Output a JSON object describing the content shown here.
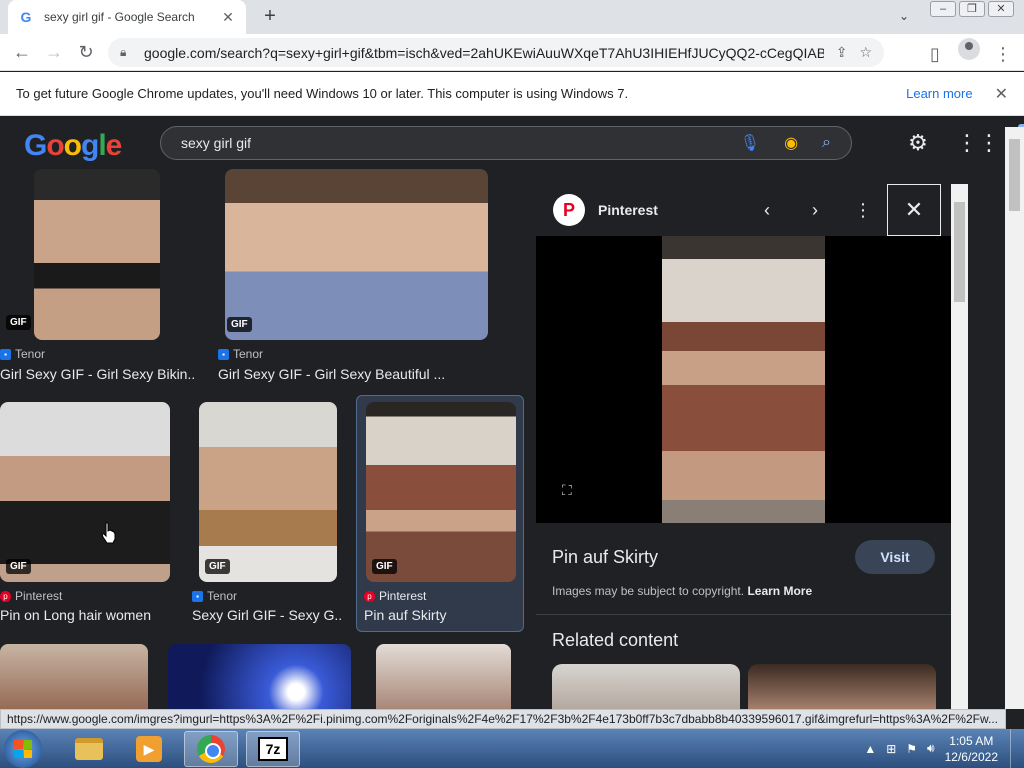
{
  "browser": {
    "tab_title": "sexy girl gif - Google Search",
    "url": "google.com/search?q=sexy+girl+gif&tbm=isch&ved=2ahUKEwiAuuWXqeT7AhU3IHIEHfJUCyQQ2-cCegQIABAA...",
    "status_url": "https://www.google.com/imgres?imgurl=https%3A%2F%2Fi.pinimg.com%2Foriginals%2F4e%2F17%2F3b%2F4e173b0ff7b3c7dbabb8b40339596017.gif&imgrefurl=https%3A%2F%2Fw..."
  },
  "infobar": {
    "message": "To get future Google Chrome updates, you'll need Windows 10 or later. This computer is using Windows 7.",
    "learn_more": "Learn more"
  },
  "google": {
    "logo_letters": [
      "G",
      "o",
      "o",
      "g",
      "l",
      "e"
    ],
    "query": "sexy girl gif"
  },
  "results": [
    {
      "source": "Tenor",
      "title": "Girl Sexy GIF - Girl Sexy Bikin...",
      "badge": "GIF"
    },
    {
      "source": "Tenor",
      "title": "Girl Sexy GIF - Girl Sexy Beautiful ...",
      "badge": "GIF"
    },
    {
      "source": "Pinterest",
      "title": "Pin on Long hair women",
      "badge": "GIF"
    },
    {
      "source": "Tenor",
      "title": "Sexy Girl GIF - Sexy G...",
      "badge": "GIF"
    },
    {
      "source": "Pinterest",
      "title": "Pin auf Skirty",
      "badge": "GIF"
    }
  ],
  "preview": {
    "site": "Pinterest",
    "title": "Pin auf Skirty",
    "visit_label": "Visit",
    "copyright": "Images may be subject to copyright.",
    "learn_more": "Learn More",
    "related_heading": "Related content"
  },
  "taskbar": {
    "time": "1:05 AM",
    "date": "12/6/2022"
  },
  "colors": {
    "accent": "#8ab4f8",
    "background": "#202124",
    "pinterest": "#e60023"
  }
}
